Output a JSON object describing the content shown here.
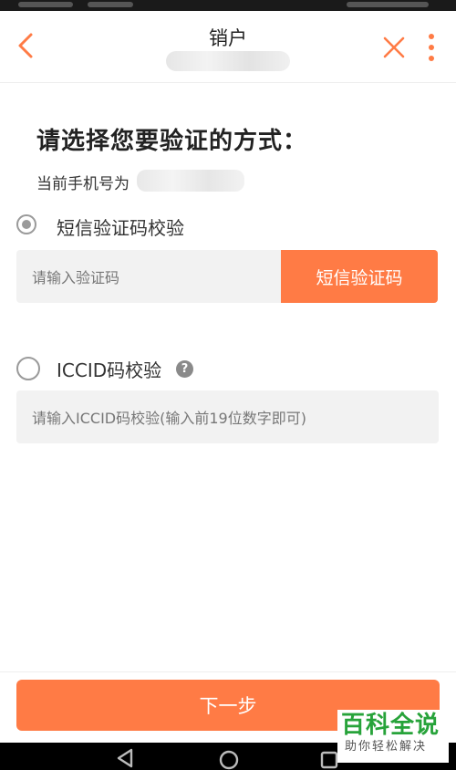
{
  "header": {
    "title": "销户",
    "back_icon": "chevron-left-icon",
    "close_icon": "close-icon",
    "more_icon": "more-vertical-icon"
  },
  "page": {
    "heading": "请选择您要验证的方式：",
    "phone_label": "当前手机号为"
  },
  "options": {
    "sms": {
      "label": "短信验证码校验",
      "selected": true,
      "input_placeholder": "请输入验证码",
      "button_label": "短信验证码"
    },
    "iccid": {
      "label": "ICCID码校验",
      "selected": false,
      "help_icon": "question-circle-icon",
      "help_glyph": "?",
      "input_placeholder": "请输入ICCID码校验(输入前19位数字即可)"
    }
  },
  "footer": {
    "next_label": "下一步"
  },
  "watermark": {
    "main": "百科全说",
    "sub": "助你轻松解决"
  },
  "colors": {
    "accent": "#ff7b45",
    "watermark_green": "#27a33a"
  }
}
